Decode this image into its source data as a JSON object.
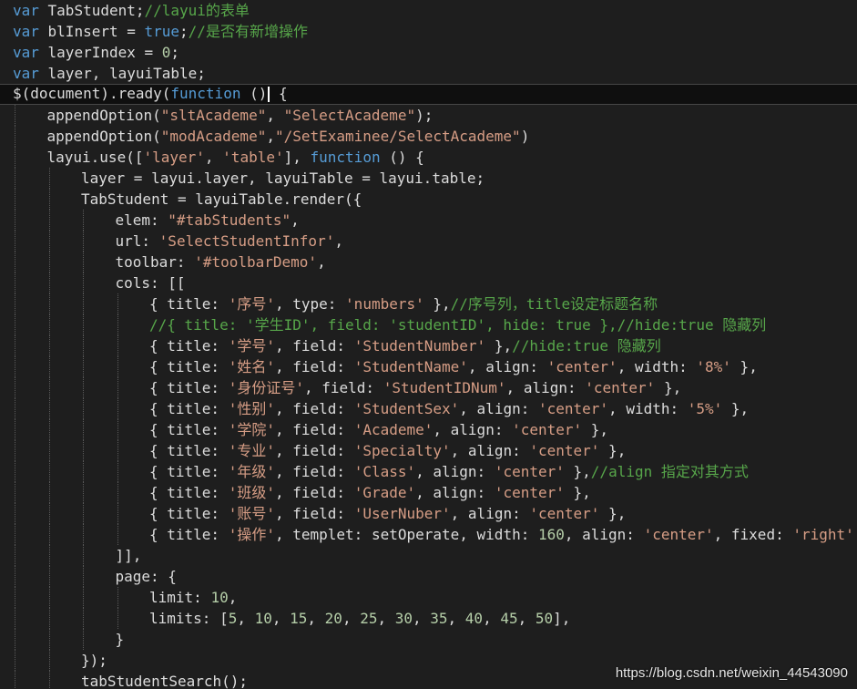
{
  "colors": {
    "background": "#1e1e1e",
    "keyword": "#569cd6",
    "comment": "#57a64a",
    "string": "#d69d85",
    "number": "#b5cea8",
    "plain": "#dcdcdc",
    "guide": "#5a5a5a",
    "current_line": "#0f0f0f"
  },
  "editor": {
    "current_line_index": 4,
    "lines": [
      {
        "indent": 0,
        "tokens": [
          {
            "t": "var",
            "k": "keyword"
          },
          {
            "t": " TabStudent;",
            "k": "plain"
          },
          {
            "t": "//layui的表单",
            "k": "comment"
          }
        ]
      },
      {
        "indent": 0,
        "tokens": [
          {
            "t": "var",
            "k": "keyword"
          },
          {
            "t": " blInsert = ",
            "k": "plain"
          },
          {
            "t": "true",
            "k": "keyword"
          },
          {
            "t": ";",
            "k": "plain"
          },
          {
            "t": "//是否有新增操作",
            "k": "comment"
          }
        ]
      },
      {
        "indent": 0,
        "tokens": [
          {
            "t": "var",
            "k": "keyword"
          },
          {
            "t": " layerIndex = ",
            "k": "plain"
          },
          {
            "t": "0",
            "k": "number"
          },
          {
            "t": ";",
            "k": "plain"
          }
        ]
      },
      {
        "indent": 0,
        "tokens": [
          {
            "t": "var",
            "k": "keyword"
          },
          {
            "t": " layer, layuiTable;",
            "k": "plain"
          }
        ]
      },
      {
        "indent": 0,
        "tokens": [
          {
            "t": "$(document).ready(",
            "k": "plain"
          },
          {
            "t": "function",
            "k": "keyword"
          },
          {
            "t": " ()",
            "k": "plain"
          },
          {
            "t": "",
            "k": "caret"
          },
          {
            "t": " {",
            "k": "plain"
          }
        ]
      },
      {
        "indent": 1,
        "tokens": [
          {
            "t": "appendOption(",
            "k": "plain"
          },
          {
            "t": "\"sltAcademe\"",
            "k": "string"
          },
          {
            "t": ", ",
            "k": "plain"
          },
          {
            "t": "\"SelectAcademe\"",
            "k": "string"
          },
          {
            "t": ");",
            "k": "plain"
          }
        ]
      },
      {
        "indent": 1,
        "tokens": [
          {
            "t": "appendOption(",
            "k": "plain"
          },
          {
            "t": "\"modAcademe\"",
            "k": "string"
          },
          {
            "t": ",",
            "k": "plain"
          },
          {
            "t": "\"/SetExaminee/SelectAcademe\"",
            "k": "string"
          },
          {
            "t": ")",
            "k": "plain"
          }
        ]
      },
      {
        "indent": 1,
        "tokens": [
          {
            "t": "layui.use([",
            "k": "plain"
          },
          {
            "t": "'layer'",
            "k": "string"
          },
          {
            "t": ", ",
            "k": "plain"
          },
          {
            "t": "'table'",
            "k": "string"
          },
          {
            "t": "], ",
            "k": "plain"
          },
          {
            "t": "function",
            "k": "keyword"
          },
          {
            "t": " () {",
            "k": "plain"
          }
        ]
      },
      {
        "indent": 2,
        "tokens": [
          {
            "t": "layer = layui.layer, layuiTable = layui.table;",
            "k": "plain"
          }
        ]
      },
      {
        "indent": 2,
        "tokens": [
          {
            "t": "TabStudent = layuiTable.render({",
            "k": "plain"
          }
        ]
      },
      {
        "indent": 3,
        "tokens": [
          {
            "t": "elem: ",
            "k": "plain"
          },
          {
            "t": "\"#tabStudents\"",
            "k": "string"
          },
          {
            "t": ",",
            "k": "plain"
          }
        ]
      },
      {
        "indent": 3,
        "tokens": [
          {
            "t": "url: ",
            "k": "plain"
          },
          {
            "t": "'SelectStudentInfor'",
            "k": "string"
          },
          {
            "t": ",",
            "k": "plain"
          }
        ]
      },
      {
        "indent": 3,
        "tokens": [
          {
            "t": "toolbar: ",
            "k": "plain"
          },
          {
            "t": "'#toolbarDemo'",
            "k": "string"
          },
          {
            "t": ",",
            "k": "plain"
          }
        ]
      },
      {
        "indent": 3,
        "tokens": [
          {
            "t": "cols: [[",
            "k": "plain"
          }
        ]
      },
      {
        "indent": 4,
        "tokens": [
          {
            "t": "{ title: ",
            "k": "plain"
          },
          {
            "t": "'序号'",
            "k": "string"
          },
          {
            "t": ", type: ",
            "k": "plain"
          },
          {
            "t": "'numbers'",
            "k": "string"
          },
          {
            "t": " },",
            "k": "plain"
          },
          {
            "t": "//序号列，title设定标题名称",
            "k": "comment"
          }
        ]
      },
      {
        "indent": 4,
        "tokens": [
          {
            "t": "//{ title: '学生ID', field: 'studentID', hide: true },//hide:true 隐藏列",
            "k": "comment"
          }
        ]
      },
      {
        "indent": 4,
        "tokens": [
          {
            "t": "{ title: ",
            "k": "plain"
          },
          {
            "t": "'学号'",
            "k": "string"
          },
          {
            "t": ", field: ",
            "k": "plain"
          },
          {
            "t": "'StudentNumber'",
            "k": "string"
          },
          {
            "t": " },",
            "k": "plain"
          },
          {
            "t": "//hide:true 隐藏列",
            "k": "comment"
          }
        ]
      },
      {
        "indent": 4,
        "tokens": [
          {
            "t": "{ title: ",
            "k": "plain"
          },
          {
            "t": "'姓名'",
            "k": "string"
          },
          {
            "t": ", field: ",
            "k": "plain"
          },
          {
            "t": "'StudentName'",
            "k": "string"
          },
          {
            "t": ", align: ",
            "k": "plain"
          },
          {
            "t": "'center'",
            "k": "string"
          },
          {
            "t": ", width: ",
            "k": "plain"
          },
          {
            "t": "'8%'",
            "k": "string"
          },
          {
            "t": " },",
            "k": "plain"
          }
        ]
      },
      {
        "indent": 4,
        "tokens": [
          {
            "t": "{ title: ",
            "k": "plain"
          },
          {
            "t": "'身份证号'",
            "k": "string"
          },
          {
            "t": ", field: ",
            "k": "plain"
          },
          {
            "t": "'StudentIDNum'",
            "k": "string"
          },
          {
            "t": ", align: ",
            "k": "plain"
          },
          {
            "t": "'center'",
            "k": "string"
          },
          {
            "t": " },",
            "k": "plain"
          }
        ]
      },
      {
        "indent": 4,
        "tokens": [
          {
            "t": "{ title: ",
            "k": "plain"
          },
          {
            "t": "'性别'",
            "k": "string"
          },
          {
            "t": ", field: ",
            "k": "plain"
          },
          {
            "t": "'StudentSex'",
            "k": "string"
          },
          {
            "t": ", align: ",
            "k": "plain"
          },
          {
            "t": "'center'",
            "k": "string"
          },
          {
            "t": ", width: ",
            "k": "plain"
          },
          {
            "t": "'5%'",
            "k": "string"
          },
          {
            "t": " },",
            "k": "plain"
          }
        ]
      },
      {
        "indent": 4,
        "tokens": [
          {
            "t": "{ title: ",
            "k": "plain"
          },
          {
            "t": "'学院'",
            "k": "string"
          },
          {
            "t": ", field: ",
            "k": "plain"
          },
          {
            "t": "'Academe'",
            "k": "string"
          },
          {
            "t": ", align: ",
            "k": "plain"
          },
          {
            "t": "'center'",
            "k": "string"
          },
          {
            "t": " },",
            "k": "plain"
          }
        ]
      },
      {
        "indent": 4,
        "tokens": [
          {
            "t": "{ title: ",
            "k": "plain"
          },
          {
            "t": "'专业'",
            "k": "string"
          },
          {
            "t": ", field: ",
            "k": "plain"
          },
          {
            "t": "'Specialty'",
            "k": "string"
          },
          {
            "t": ", align: ",
            "k": "plain"
          },
          {
            "t": "'center'",
            "k": "string"
          },
          {
            "t": " },",
            "k": "plain"
          }
        ]
      },
      {
        "indent": 4,
        "tokens": [
          {
            "t": "{ title: ",
            "k": "plain"
          },
          {
            "t": "'年级'",
            "k": "string"
          },
          {
            "t": ", field: ",
            "k": "plain"
          },
          {
            "t": "'Class'",
            "k": "string"
          },
          {
            "t": ", align: ",
            "k": "plain"
          },
          {
            "t": "'center'",
            "k": "string"
          },
          {
            "t": " },",
            "k": "plain"
          },
          {
            "t": "//align 指定对其方式",
            "k": "comment"
          }
        ]
      },
      {
        "indent": 4,
        "tokens": [
          {
            "t": "{ title: ",
            "k": "plain"
          },
          {
            "t": "'班级'",
            "k": "string"
          },
          {
            "t": ", field: ",
            "k": "plain"
          },
          {
            "t": "'Grade'",
            "k": "string"
          },
          {
            "t": ", align: ",
            "k": "plain"
          },
          {
            "t": "'center'",
            "k": "string"
          },
          {
            "t": " },",
            "k": "plain"
          }
        ]
      },
      {
        "indent": 4,
        "tokens": [
          {
            "t": "{ title: ",
            "k": "plain"
          },
          {
            "t": "'账号'",
            "k": "string"
          },
          {
            "t": ", field: ",
            "k": "plain"
          },
          {
            "t": "'UserNuber'",
            "k": "string"
          },
          {
            "t": ", align: ",
            "k": "plain"
          },
          {
            "t": "'center'",
            "k": "string"
          },
          {
            "t": " },",
            "k": "plain"
          }
        ]
      },
      {
        "indent": 4,
        "tokens": [
          {
            "t": "{ title: ",
            "k": "plain"
          },
          {
            "t": "'操作'",
            "k": "string"
          },
          {
            "t": ", templet: setOperate, width: ",
            "k": "plain"
          },
          {
            "t": "160",
            "k": "number"
          },
          {
            "t": ", align: ",
            "k": "plain"
          },
          {
            "t": "'center'",
            "k": "string"
          },
          {
            "t": ", fixed: ",
            "k": "plain"
          },
          {
            "t": "'right'",
            "k": "string"
          },
          {
            "t": " }",
            "k": "plain"
          }
        ]
      },
      {
        "indent": 3,
        "tokens": [
          {
            "t": "]],",
            "k": "plain"
          }
        ]
      },
      {
        "indent": 3,
        "tokens": [
          {
            "t": "page: {",
            "k": "plain"
          }
        ]
      },
      {
        "indent": 4,
        "tokens": [
          {
            "t": "limit: ",
            "k": "plain"
          },
          {
            "t": "10",
            "k": "number"
          },
          {
            "t": ",",
            "k": "plain"
          }
        ]
      },
      {
        "indent": 4,
        "tokens": [
          {
            "t": "limits: [",
            "k": "plain"
          },
          {
            "t": "5",
            "k": "number"
          },
          {
            "t": ", ",
            "k": "plain"
          },
          {
            "t": "10",
            "k": "number"
          },
          {
            "t": ", ",
            "k": "plain"
          },
          {
            "t": "15",
            "k": "number"
          },
          {
            "t": ", ",
            "k": "plain"
          },
          {
            "t": "20",
            "k": "number"
          },
          {
            "t": ", ",
            "k": "plain"
          },
          {
            "t": "25",
            "k": "number"
          },
          {
            "t": ", ",
            "k": "plain"
          },
          {
            "t": "30",
            "k": "number"
          },
          {
            "t": ", ",
            "k": "plain"
          },
          {
            "t": "35",
            "k": "number"
          },
          {
            "t": ", ",
            "k": "plain"
          },
          {
            "t": "40",
            "k": "number"
          },
          {
            "t": ", ",
            "k": "plain"
          },
          {
            "t": "45",
            "k": "number"
          },
          {
            "t": ", ",
            "k": "plain"
          },
          {
            "t": "50",
            "k": "number"
          },
          {
            "t": "],",
            "k": "plain"
          }
        ]
      },
      {
        "indent": 3,
        "tokens": [
          {
            "t": "}",
            "k": "plain"
          }
        ]
      },
      {
        "indent": 2,
        "tokens": [
          {
            "t": "});",
            "k": "plain"
          }
        ]
      },
      {
        "indent": 2,
        "tokens": [
          {
            "t": "tabStudentSearch();",
            "k": "plain"
          }
        ]
      }
    ]
  },
  "watermark": "https://blog.csdn.net/weixin_44543090"
}
